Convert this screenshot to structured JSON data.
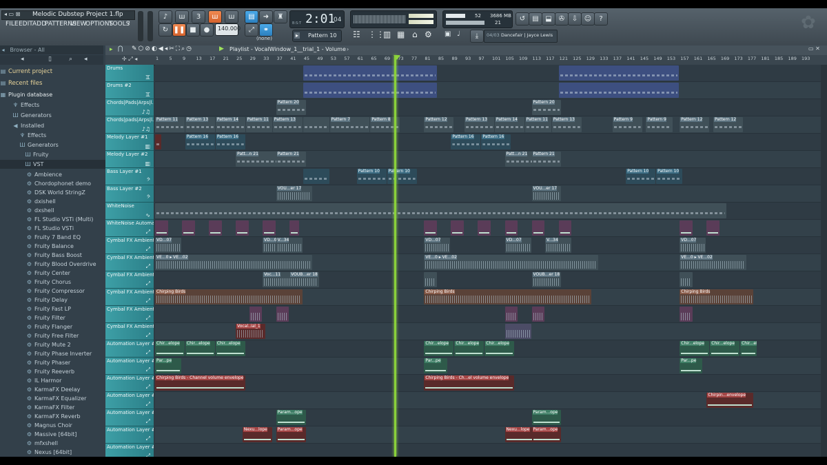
{
  "window": {
    "title": "Melodic Dubstep Project 1.flp",
    "menu": [
      "FILE",
      "EDIT",
      "ADD",
      "PATTERNS",
      "VIEW",
      "OPTIONS",
      "TOOLS",
      "?"
    ]
  },
  "toolbar": {
    "time": "2:01",
    "time_sub": "04",
    "time_label": "B:S:T",
    "tempo": "140.000",
    "pattern": "Pattern 10",
    "snap": "(none)",
    "cpu_value": "52",
    "memory": "3686 MB",
    "polyphony": "21",
    "hint_counter": "04/03",
    "hint_text": "Dancefair | Jayce Lewis",
    "accent_color": "#f07b3f"
  },
  "browser": {
    "title": "Browser - All",
    "current_project": "Current project",
    "recent_files": "Recent files",
    "plugin_database": "Plugin database",
    "effects": "Effects",
    "generators": "Generators",
    "installed": "Installed",
    "installed_effects": "Effects",
    "installed_generators": "Generators",
    "fruity": "Fruity",
    "vst": "VST",
    "plugins": [
      "Ambience",
      "Chordophonet demo",
      "DSK World StringZ",
      "dxishell",
      "dxshell",
      "FL Studio VSTi (Multi)",
      "FL Studio VSTi",
      "Fruity 7 Band EQ",
      "Fruity Balance",
      "Fruity Bass Boost",
      "Fruity Blood Overdrive",
      "Fruity Center",
      "Fruity Chorus",
      "Fruity Compressor",
      "Fruity Delay",
      "Fruity Fast LP",
      "Fruity Filter",
      "Fruity Flanger",
      "Fruity Free Filter",
      "Fruity Mute 2",
      "Fruity Phase Inverter",
      "Fruity Phaser",
      "Fruity Reeverb",
      "IL Harmor",
      "KarmaFX Deelay",
      "KarmaFX Equalizer",
      "KarmaFX Filter",
      "KarmaFX Reverb",
      "Magnus Choir",
      "Massive [64bit]",
      "mfxshell",
      "Nexus [64bit]"
    ]
  },
  "playlist": {
    "title": "Playlist - VocalWindow_1__trial_1 - Volume",
    "ruler": [
      "1",
      "5",
      "9",
      "13",
      "17",
      "21",
      "25",
      "29",
      "33",
      "37",
      "41",
      "45",
      "49",
      "53",
      "57",
      "61",
      "65",
      "69",
      "73",
      "77",
      "81",
      "85",
      "89",
      "93",
      "97",
      "101",
      "105",
      "109",
      "113",
      "117",
      "121",
      "125",
      "129",
      "133",
      "137",
      "141",
      "145",
      "149",
      "153",
      "157",
      "161",
      "165",
      "169",
      "173",
      "177",
      "181",
      "185",
      "189",
      "193"
    ],
    "tracks": [
      {
        "name": "Drums",
        "icon": "drum-icon"
      },
      {
        "name": "Drums #2",
        "icon": "drum-icon"
      },
      {
        "name": "Chords|Pads|Arps|l..",
        "icon": "notes-icon"
      },
      {
        "name": "Chords|pads|Arps|l..",
        "icon": "notes-icon"
      },
      {
        "name": "Melody Layer #1",
        "icon": "piano-icon"
      },
      {
        "name": "Melody Layer #2",
        "icon": "piano-icon"
      },
      {
        "name": "Bass Layer #1",
        "icon": "bass-clef-icon"
      },
      {
        "name": "Bass Layer #2",
        "icon": "bass-clef-icon"
      },
      {
        "name": "WhiteNoise",
        "icon": "wave-icon"
      },
      {
        "name": "WhiteNoise Automat..",
        "icon": "automation-icon"
      },
      {
        "name": "Cymbal FX Ambient",
        "icon": "automation-icon"
      },
      {
        "name": "Cymbal FX Ambient",
        "icon": "automation-icon"
      },
      {
        "name": "Cymbal FX Ambient",
        "icon": "automation-icon"
      },
      {
        "name": "Cymbal FX Ambient",
        "icon": "automation-icon"
      },
      {
        "name": "Cymbal FX Ambient",
        "icon": "automation-icon"
      },
      {
        "name": "Cymbal FX Ambient",
        "icon": "automation-icon"
      },
      {
        "name": "Automation Layer #1",
        "icon": "automation-icon"
      },
      {
        "name": "Automation Layer #2",
        "icon": "automation-icon"
      },
      {
        "name": "Automation Layer #3",
        "icon": "automation-icon"
      },
      {
        "name": "Automation Layer #4",
        "icon": "automation-icon"
      },
      {
        "name": "Automation Layer #5",
        "icon": "automation-icon"
      },
      {
        "name": "Automation Layer #6",
        "icon": "automation-icon"
      },
      {
        "name": "Automation Layer #7",
        "icon": "automation-icon"
      }
    ],
    "clip_labels": {
      "p20": "Pattern 20",
      "p11": "Pattern 11",
      "p13": "Pattern 13",
      "p14": "Pattern 14",
      "p7": "Pattern 7",
      "p8": "Pattern 8",
      "p12": "Pattern 12",
      "p9": "Pattern 9",
      "p16": "Pattern 16",
      "p21": "Patt...n 21",
      "p21b": "Pattern 21",
      "p10": "Pattern 10",
      "vou17": "VOU...er 17",
      "vd07": "VD...07",
      "v34": "V...34",
      "ve02": "VE...0 ▸ VE...02",
      "voc11": "Voc...11",
      "voub18": "VOUB...er 18",
      "chirping": "Chirping Birds",
      "vocal1": "Vocal..ial_1",
      "chir_env": "Chir...elope",
      "par": "Par...pe",
      "chirp_vol": "Chirping Birds - Channel volume envelope",
      "chirp_vol2": "Chirping Birds - Ch...el volume envelope",
      "chirpin_env": "Chirpin...envelope",
      "param": "Param...ope",
      "nexu": "Nexu...lope"
    }
  }
}
